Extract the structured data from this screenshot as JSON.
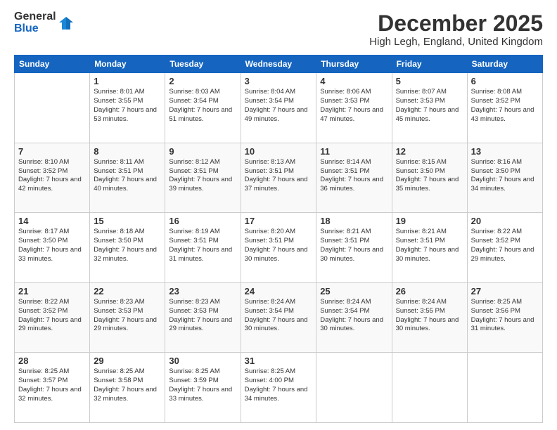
{
  "logo": {
    "general": "General",
    "blue": "Blue"
  },
  "header": {
    "month": "December 2025",
    "location": "High Legh, England, United Kingdom"
  },
  "days": [
    "Sunday",
    "Monday",
    "Tuesday",
    "Wednesday",
    "Thursday",
    "Friday",
    "Saturday"
  ],
  "weeks": [
    [
      {
        "day": "",
        "sunrise": "",
        "sunset": "",
        "daylight": ""
      },
      {
        "day": "1",
        "sunrise": "Sunrise: 8:01 AM",
        "sunset": "Sunset: 3:55 PM",
        "daylight": "Daylight: 7 hours and 53 minutes."
      },
      {
        "day": "2",
        "sunrise": "Sunrise: 8:03 AM",
        "sunset": "Sunset: 3:54 PM",
        "daylight": "Daylight: 7 hours and 51 minutes."
      },
      {
        "day": "3",
        "sunrise": "Sunrise: 8:04 AM",
        "sunset": "Sunset: 3:54 PM",
        "daylight": "Daylight: 7 hours and 49 minutes."
      },
      {
        "day": "4",
        "sunrise": "Sunrise: 8:06 AM",
        "sunset": "Sunset: 3:53 PM",
        "daylight": "Daylight: 7 hours and 47 minutes."
      },
      {
        "day": "5",
        "sunrise": "Sunrise: 8:07 AM",
        "sunset": "Sunset: 3:53 PM",
        "daylight": "Daylight: 7 hours and 45 minutes."
      },
      {
        "day": "6",
        "sunrise": "Sunrise: 8:08 AM",
        "sunset": "Sunset: 3:52 PM",
        "daylight": "Daylight: 7 hours and 43 minutes."
      }
    ],
    [
      {
        "day": "7",
        "sunrise": "Sunrise: 8:10 AM",
        "sunset": "Sunset: 3:52 PM",
        "daylight": "Daylight: 7 hours and 42 minutes."
      },
      {
        "day": "8",
        "sunrise": "Sunrise: 8:11 AM",
        "sunset": "Sunset: 3:51 PM",
        "daylight": "Daylight: 7 hours and 40 minutes."
      },
      {
        "day": "9",
        "sunrise": "Sunrise: 8:12 AM",
        "sunset": "Sunset: 3:51 PM",
        "daylight": "Daylight: 7 hours and 39 minutes."
      },
      {
        "day": "10",
        "sunrise": "Sunrise: 8:13 AM",
        "sunset": "Sunset: 3:51 PM",
        "daylight": "Daylight: 7 hours and 37 minutes."
      },
      {
        "day": "11",
        "sunrise": "Sunrise: 8:14 AM",
        "sunset": "Sunset: 3:51 PM",
        "daylight": "Daylight: 7 hours and 36 minutes."
      },
      {
        "day": "12",
        "sunrise": "Sunrise: 8:15 AM",
        "sunset": "Sunset: 3:50 PM",
        "daylight": "Daylight: 7 hours and 35 minutes."
      },
      {
        "day": "13",
        "sunrise": "Sunrise: 8:16 AM",
        "sunset": "Sunset: 3:50 PM",
        "daylight": "Daylight: 7 hours and 34 minutes."
      }
    ],
    [
      {
        "day": "14",
        "sunrise": "Sunrise: 8:17 AM",
        "sunset": "Sunset: 3:50 PM",
        "daylight": "Daylight: 7 hours and 33 minutes."
      },
      {
        "day": "15",
        "sunrise": "Sunrise: 8:18 AM",
        "sunset": "Sunset: 3:50 PM",
        "daylight": "Daylight: 7 hours and 32 minutes."
      },
      {
        "day": "16",
        "sunrise": "Sunrise: 8:19 AM",
        "sunset": "Sunset: 3:51 PM",
        "daylight": "Daylight: 7 hours and 31 minutes."
      },
      {
        "day": "17",
        "sunrise": "Sunrise: 8:20 AM",
        "sunset": "Sunset: 3:51 PM",
        "daylight": "Daylight: 7 hours and 30 minutes."
      },
      {
        "day": "18",
        "sunrise": "Sunrise: 8:21 AM",
        "sunset": "Sunset: 3:51 PM",
        "daylight": "Daylight: 7 hours and 30 minutes."
      },
      {
        "day": "19",
        "sunrise": "Sunrise: 8:21 AM",
        "sunset": "Sunset: 3:51 PM",
        "daylight": "Daylight: 7 hours and 30 minutes."
      },
      {
        "day": "20",
        "sunrise": "Sunrise: 8:22 AM",
        "sunset": "Sunset: 3:52 PM",
        "daylight": "Daylight: 7 hours and 29 minutes."
      }
    ],
    [
      {
        "day": "21",
        "sunrise": "Sunrise: 8:22 AM",
        "sunset": "Sunset: 3:52 PM",
        "daylight": "Daylight: 7 hours and 29 minutes."
      },
      {
        "day": "22",
        "sunrise": "Sunrise: 8:23 AM",
        "sunset": "Sunset: 3:53 PM",
        "daylight": "Daylight: 7 hours and 29 minutes."
      },
      {
        "day": "23",
        "sunrise": "Sunrise: 8:23 AM",
        "sunset": "Sunset: 3:53 PM",
        "daylight": "Daylight: 7 hours and 29 minutes."
      },
      {
        "day": "24",
        "sunrise": "Sunrise: 8:24 AM",
        "sunset": "Sunset: 3:54 PM",
        "daylight": "Daylight: 7 hours and 30 minutes."
      },
      {
        "day": "25",
        "sunrise": "Sunrise: 8:24 AM",
        "sunset": "Sunset: 3:54 PM",
        "daylight": "Daylight: 7 hours and 30 minutes."
      },
      {
        "day": "26",
        "sunrise": "Sunrise: 8:24 AM",
        "sunset": "Sunset: 3:55 PM",
        "daylight": "Daylight: 7 hours and 30 minutes."
      },
      {
        "day": "27",
        "sunrise": "Sunrise: 8:25 AM",
        "sunset": "Sunset: 3:56 PM",
        "daylight": "Daylight: 7 hours and 31 minutes."
      }
    ],
    [
      {
        "day": "28",
        "sunrise": "Sunrise: 8:25 AM",
        "sunset": "Sunset: 3:57 PM",
        "daylight": "Daylight: 7 hours and 32 minutes."
      },
      {
        "day": "29",
        "sunrise": "Sunrise: 8:25 AM",
        "sunset": "Sunset: 3:58 PM",
        "daylight": "Daylight: 7 hours and 32 minutes."
      },
      {
        "day": "30",
        "sunrise": "Sunrise: 8:25 AM",
        "sunset": "Sunset: 3:59 PM",
        "daylight": "Daylight: 7 hours and 33 minutes."
      },
      {
        "day": "31",
        "sunrise": "Sunrise: 8:25 AM",
        "sunset": "Sunset: 4:00 PM",
        "daylight": "Daylight: 7 hours and 34 minutes."
      },
      {
        "day": "",
        "sunrise": "",
        "sunset": "",
        "daylight": ""
      },
      {
        "day": "",
        "sunrise": "",
        "sunset": "",
        "daylight": ""
      },
      {
        "day": "",
        "sunrise": "",
        "sunset": "",
        "daylight": ""
      }
    ]
  ]
}
